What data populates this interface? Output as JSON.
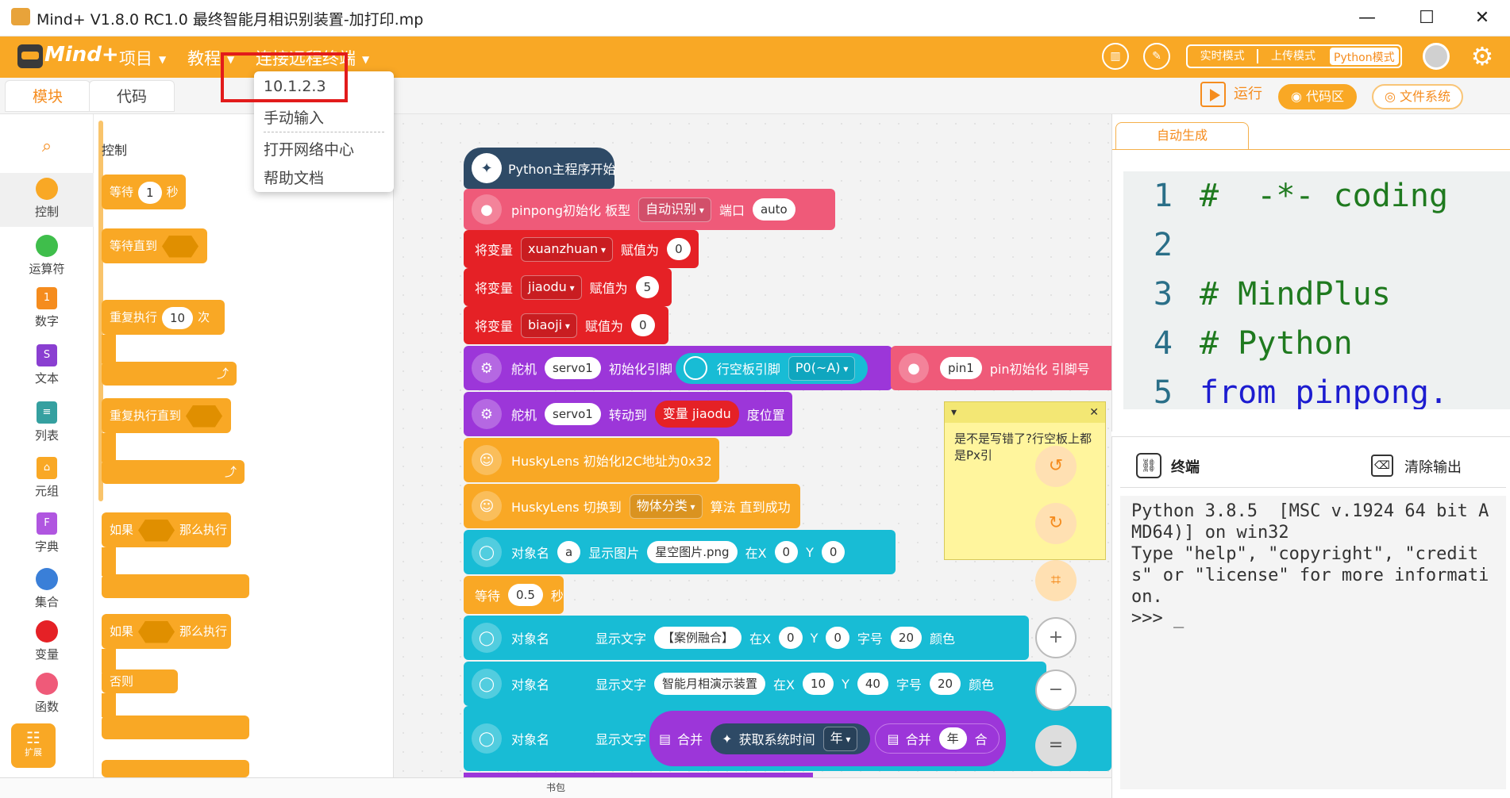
{
  "window": {
    "title": "Mind+ V1.8.0 RC1.0   最终智能月相识别装置-加打印.mp",
    "minimize": "—",
    "maximize": "☐",
    "close": "✕"
  },
  "menubar": {
    "logo": "Mind+",
    "menus": [
      "项目",
      "教程",
      "连接远程终端"
    ],
    "modes": {
      "realtime": "实时模式",
      "upload": "上传模式",
      "python": "Python模式"
    },
    "active_mode": "Python模式"
  },
  "connect_dropdown": {
    "items": [
      "10.1.2.3",
      "手动输入",
      "打开网络中心",
      "帮助文档"
    ],
    "highlighted": "10.1.2.3"
  },
  "tabs": {
    "blocks": "模块",
    "code": "代码",
    "active": "模块"
  },
  "toolbar": {
    "run": "运行",
    "code_area": "代码区",
    "file_system": "文件系统"
  },
  "categories": [
    {
      "label": "控制",
      "color": "#f9a825",
      "icon": "dot"
    },
    {
      "label": "运算符",
      "color": "#3fbe4b",
      "icon": "dot"
    },
    {
      "label": "数字",
      "color": "#f58c1e",
      "icon": "square"
    },
    {
      "label": "文本",
      "color": "#8a3fd1",
      "icon": "square"
    },
    {
      "label": "列表",
      "color": "#35a0a0",
      "icon": "clipboard"
    },
    {
      "label": "元组",
      "color": "#f9a825",
      "icon": "lock"
    },
    {
      "label": "字典",
      "color": "#b056e0",
      "icon": "square"
    },
    {
      "label": "集合",
      "color": "#3a7fd8",
      "icon": "circles"
    },
    {
      "label": "变量",
      "color": "#e52126",
      "icon": "dot"
    },
    {
      "label": "函数",
      "color": "#ef5a79",
      "icon": "dot"
    }
  ],
  "extension_button": "扩展",
  "palette": {
    "heading": "控制",
    "wait": {
      "label": "等待",
      "value": "1",
      "unit": "秒"
    },
    "wait_until": "等待直到",
    "repeat": {
      "label": "重复执行",
      "value": "10",
      "unit": "次"
    },
    "repeat_until": "重复执行直到",
    "if_then": {
      "if": "如果",
      "then": "那么执行"
    },
    "if_else": {
      "if": "如果",
      "then": "那么执行",
      "else": "否则"
    }
  },
  "script": {
    "start": "Python主程序开始",
    "pinpong_init": {
      "label": "pinpong初始化 板型",
      "board": "自动识别",
      "port_label": "端口",
      "port": "auto"
    },
    "vars": [
      {
        "label": "将变量",
        "name": "xuanzhuan",
        "assign": "赋值为",
        "value": "0"
      },
      {
        "label": "将变量",
        "name": "jiaodu",
        "assign": "赋值为",
        "value": "5"
      },
      {
        "label": "将变量",
        "name": "biaoji",
        "assign": "赋值为",
        "value": "0"
      }
    ],
    "servo_init": {
      "label": "舵机",
      "servo": "servo1",
      "init": "初始化引脚",
      "board_pin": "行空板引脚",
      "pin": "P0(~A)"
    },
    "pin_init_side": {
      "name": "pin1",
      "label": "pin初始化 引脚号"
    },
    "servo_turn": {
      "label": "舵机",
      "servo": "servo1",
      "turn": "转动到",
      "var_label": "变量",
      "var": "jiaodu",
      "unit": "度位置"
    },
    "husky_init": "HuskyLens 初始化I2C地址为0x32",
    "husky_switch": {
      "label": "HuskyLens 切换到",
      "algo": "物体分类",
      "suffix": "算法 直到成功"
    },
    "show_image": {
      "obj_label": "对象名",
      "obj": "a",
      "action": "显示图片",
      "file": "星空图片.png",
      "x_label": "在X",
      "x": "0",
      "y_label": "Y",
      "y": "0"
    },
    "wait": {
      "label": "等待",
      "value": "0.5",
      "unit": "秒"
    },
    "text1": {
      "obj_label": "对象名",
      "obj": "",
      "action": "显示文字",
      "text": "【案例融合】",
      "x_label": "在X",
      "x": "0",
      "y_label": "Y",
      "y": "0",
      "size_label": "字号",
      "size": "20",
      "color_label": "颜色"
    },
    "text2": {
      "obj_label": "对象名",
      "obj": "",
      "action": "显示文字",
      "text": "智能月相演示装置",
      "x_label": "在X",
      "x": "10",
      "y_label": "Y",
      "y": "40",
      "size_label": "字号",
      "size": "20",
      "color_label": "颜色"
    },
    "text3": {
      "obj_label": "对象名",
      "obj": "",
      "action": "显示文字",
      "merge": "合并",
      "time_label": "获取系统时间",
      "time_unit": "年",
      "merge2": "合并",
      "year": "年",
      "merge3": "合"
    }
  },
  "note": {
    "text": "是不是写错了?行空板上都是Px引"
  },
  "code": {
    "tab": "自动生成",
    "lines": [
      {
        "n": "1",
        "text": "#  -*- coding",
        "type": "comment"
      },
      {
        "n": "2",
        "text": "",
        "type": "plain"
      },
      {
        "n": "3",
        "text": "# MindPlus",
        "type": "comment"
      },
      {
        "n": "4",
        "text": "# Python",
        "type": "comment"
      },
      {
        "n": "5",
        "text": "from pinpong.",
        "type": "kw"
      }
    ]
  },
  "terminal": {
    "title": "终端",
    "clear": "清除输出",
    "output": "Python 3.8.5  [MSC v.1924 64 bit AMD64)] on win32\nType \"help\", \"copyright\", \"credits\" or \"license\" for more information.\n>>> _"
  },
  "bottom": {
    "backpack": "书包"
  }
}
